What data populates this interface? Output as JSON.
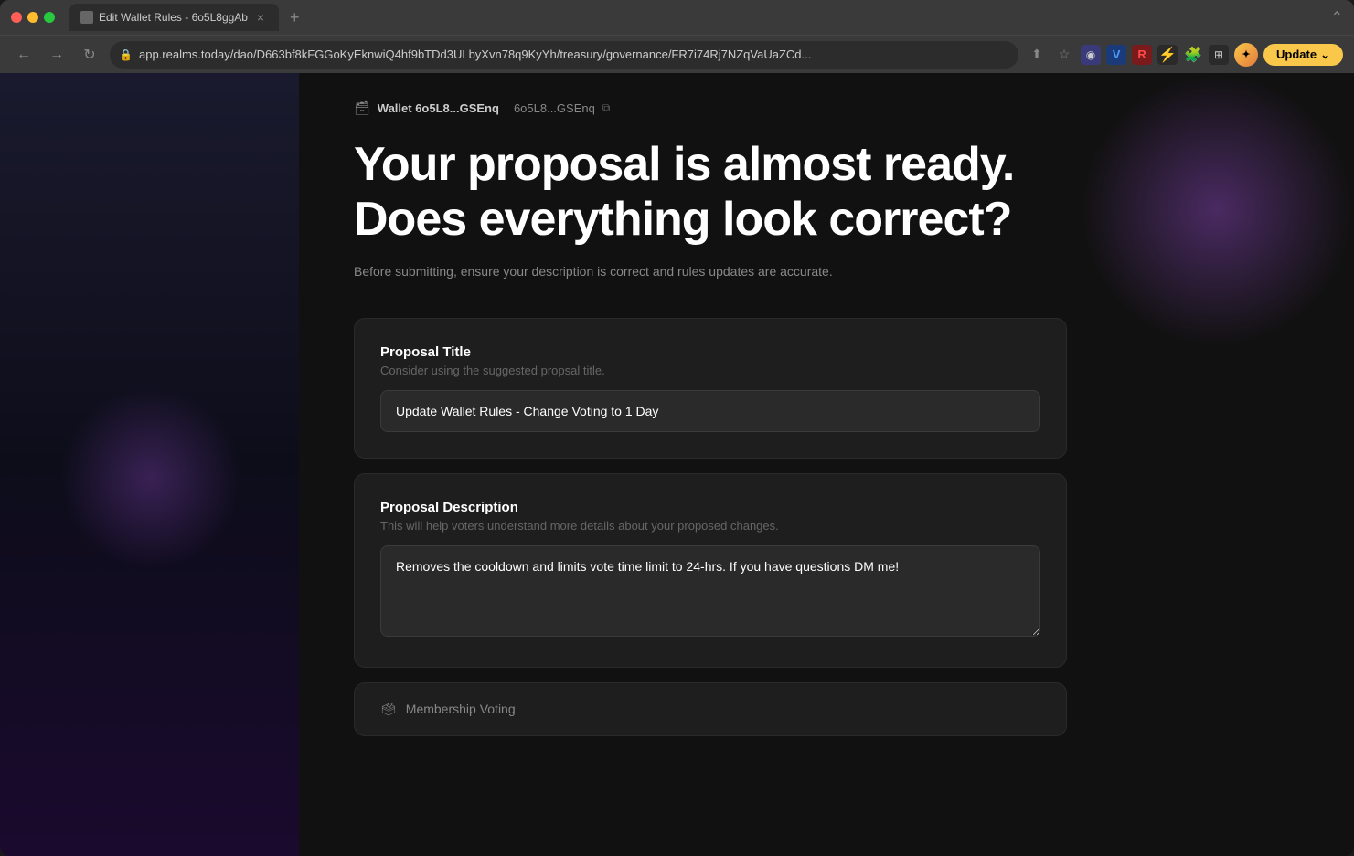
{
  "browser": {
    "tab_title": "Edit Wallet Rules - 6o5L8ggAb",
    "tab_favicon": "📄",
    "url": "app.realms.today/dao/D663bf8kFGGoKyEknwiQ4hf9bTDd3ULbyXvn78q9KyYh/treasury/governance/FR7i74Rj7NZqVaUaZCd...",
    "update_button": "Update",
    "nav": {
      "back": "←",
      "forward": "→",
      "refresh": "↻"
    }
  },
  "breadcrumb": {
    "wallet_label": "Wallet 6o5L8...GSEnq",
    "address": "6o5L8...GSEnq",
    "copy_title": "Copy address"
  },
  "page": {
    "heading_line1": "Your proposal is almost ready.",
    "heading_line2": "Does everything look correct?",
    "subtitle": "Before submitting, ensure your description is correct and rules updates are accurate."
  },
  "proposal_title_section": {
    "label": "Proposal Title",
    "hint": "Consider using the suggested propsal title.",
    "value": "Update Wallet Rules - Change Voting to 1 Day"
  },
  "proposal_description_section": {
    "label": "Proposal Description",
    "hint": "This will help voters understand more details about your proposed changes.",
    "value": "Removes the cooldown and limits vote time limit to 24-hrs. If you have questions DM me!"
  },
  "membership_voting": {
    "label": "Membership Voting",
    "icon": "🗳"
  }
}
